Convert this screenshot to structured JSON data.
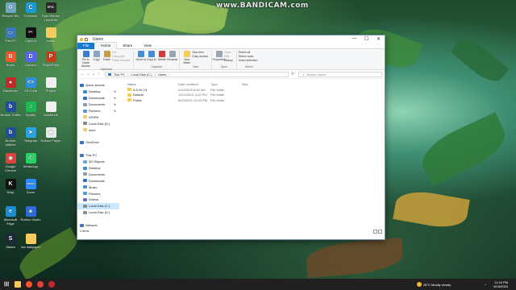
{
  "watermark": "www.BANDICAM.com",
  "desktop_icons": [
    {
      "label": "Recycle Bin",
      "icon": "recycle-bin-icon",
      "color": "#6fa7c9",
      "glyph": "♻"
    },
    {
      "label": "CCleaner",
      "icon": "ccleaner-icon",
      "color": "#1b9ad6",
      "glyph": "C"
    },
    {
      "label": "Epic Games Launcher",
      "icon": "epic-games-icon",
      "color": "#2a2a2a",
      "glyph": "EPIC"
    },
    {
      "label": "This PC",
      "icon": "this-pc-icon",
      "color": "#3a78c2",
      "glyph": "▭"
    },
    {
      "label": "CapCut",
      "icon": "capcut-icon",
      "color": "#111111",
      "glyph": "✂"
    },
    {
      "label": "cursor",
      "icon": "folder-icon",
      "color": "#f6cb5e",
      "glyph": ""
    },
    {
      "label": "Brave",
      "icon": "brave-icon",
      "color": "#fb542b",
      "glyph": "B"
    },
    {
      "label": "Discord",
      "icon": "discord-icon",
      "color": "#5865f2",
      "glyph": "D"
    },
    {
      "label": "PowerPoint",
      "icon": "powerpoint-icon",
      "color": "#c43e1c",
      "glyph": "P"
    },
    {
      "label": "Bandicam",
      "icon": "bandicam-icon",
      "color": "#c62828",
      "glyph": "●"
    },
    {
      "label": "VS Code",
      "icon": "vscode-icon",
      "color": "#2f8fdb",
      "glyph": "<>"
    },
    {
      "label": "Project",
      "icon": "project-icon",
      "color": "#f0f0f0",
      "glyph": ""
    },
    {
      "label": "Brother Crafts",
      "icon": "brother-icon",
      "color": "#1e4e9c",
      "glyph": "b"
    },
    {
      "label": "Spotify",
      "icon": "spotify-icon",
      "color": "#1db954",
      "glyph": "♫"
    },
    {
      "label": "AnkiMonk",
      "icon": "anki-icon",
      "color": "#f0f0f0",
      "glyph": ""
    },
    {
      "label": "Brother Utilities",
      "icon": "brother-utilities-icon",
      "color": "#1e4e9c",
      "glyph": "b"
    },
    {
      "label": "Telegram",
      "icon": "telegram-icon",
      "color": "#2aa3df",
      "glyph": "➤"
    },
    {
      "label": "Roblox Player",
      "icon": "roblox-icon",
      "color": "#e8e8e8",
      "glyph": "◆"
    },
    {
      "label": "Google Chrome",
      "icon": "chrome-icon",
      "color": "#e0413a",
      "glyph": "◉"
    },
    {
      "label": "WhatsApp",
      "icon": "whatsapp-icon",
      "color": "#25d366",
      "glyph": "✆"
    },
    {
      "label": "Krisp",
      "icon": "krisp-icon",
      "color": "#111111",
      "glyph": "K"
    },
    {
      "label": "Zoom",
      "icon": "zoom-icon",
      "color": "#2d8cff",
      "glyph": "zoom"
    },
    {
      "label": "Microsoft Edge",
      "icon": "edge-icon",
      "color": "#1b8fd6",
      "glyph": "e"
    },
    {
      "label": "Roblox Studio",
      "icon": "roblox-studio-icon",
      "color": "#2c6bd8",
      "glyph": "◈"
    },
    {
      "label": "Steam",
      "icon": "steam-icon",
      "color": "#1b2838",
      "glyph": "S"
    },
    {
      "label": "live wallpaper",
      "icon": "folder-icon",
      "color": "#f6cb5e",
      "glyph": ""
    }
  ],
  "window": {
    "title": "Users",
    "controls": {
      "minimize": "—",
      "maximize": "☐",
      "close": "✕"
    },
    "tabs": [
      {
        "label": "File",
        "kind": "file"
      },
      {
        "label": "Home",
        "kind": "active"
      },
      {
        "label": "Share",
        "kind": ""
      },
      {
        "label": "View",
        "kind": ""
      }
    ],
    "ribbon": {
      "clipboard": {
        "name": "Clipboard",
        "pin_label": "Pin to Quick access",
        "copy_label": "Copy",
        "paste_label": "Paste",
        "cut": "Cut",
        "copy_path": "Copy path",
        "paste_shortcut": "Paste shortcut"
      },
      "organize": {
        "name": "Organize",
        "move_label": "Move to",
        "copy_label": "Copy to",
        "delete_label": "Delete",
        "rename_label": "Rename"
      },
      "new": {
        "name": "New",
        "new_folder": "New folder",
        "new_item": "New item",
        "easy_access": "Easy access"
      },
      "open": {
        "name": "Open",
        "properties": "Properties",
        "open": "Open",
        "edit": "Edit",
        "history": "History"
      },
      "select": {
        "name": "Select",
        "select_all": "Select all",
        "select_none": "Select none",
        "invert": "Invert selection"
      }
    },
    "address": {
      "back": "←",
      "forward": "→",
      "recent": "⌄",
      "up": "↑",
      "crumbs": [
        "This PC",
        "›",
        "Local Disk (C:)",
        "›",
        "Users",
        "›"
      ],
      "refresh": "↻",
      "search_icon": "⌕",
      "search_placeholder": "Search Users"
    },
    "nav_pane": [
      {
        "label": "Quick access",
        "level": "top",
        "icon_color": "#2a73cc",
        "pinned": false
      },
      {
        "label": "Desktop",
        "level": "",
        "icon_color": "#3a8bd8",
        "pinned": true
      },
      {
        "label": "Downloads",
        "level": "",
        "icon_color": "#2a73cc",
        "pinned": true
      },
      {
        "label": "Documents",
        "level": "",
        "icon_color": "#8a9bb3",
        "pinned": true
      },
      {
        "label": "Pictures",
        "level": "",
        "icon_color": "#4aa0d6",
        "pinned": true
      },
      {
        "label": "WORK",
        "level": "",
        "icon_color": "#f6cb5e",
        "pinned": false
      },
      {
        "label": "Local Disk (D:)",
        "level": "",
        "icon_color": "#8a8a8a",
        "pinned": false
      },
      {
        "label": "work",
        "level": "",
        "icon_color": "#f6cb5e",
        "pinned": false
      },
      {
        "label": "",
        "level": "",
        "icon_color": "transparent",
        "pinned": false
      },
      {
        "label": "OneDrive",
        "level": "top",
        "icon_color": "#2a73cc",
        "pinned": false
      },
      {
        "label": "",
        "level": "",
        "icon_color": "transparent",
        "pinned": false
      },
      {
        "label": "This PC",
        "level": "top",
        "icon_color": "#3a78c2",
        "pinned": false
      },
      {
        "label": "3D Objects",
        "level": "",
        "icon_color": "#5aaee8",
        "pinned": false
      },
      {
        "label": "Desktop",
        "level": "",
        "icon_color": "#3a8bd8",
        "pinned": false
      },
      {
        "label": "Documents",
        "level": "",
        "icon_color": "#8a9bb3",
        "pinned": false
      },
      {
        "label": "Downloads",
        "level": "",
        "icon_color": "#2a73cc",
        "pinned": false
      },
      {
        "label": "Music",
        "level": "",
        "icon_color": "#4a8fd6",
        "pinned": false
      },
      {
        "label": "Pictures",
        "level": "",
        "icon_color": "#4aa0d6",
        "pinned": false
      },
      {
        "label": "Videos",
        "level": "",
        "icon_color": "#6a6ad0",
        "pinned": false
      },
      {
        "label": "Local Disk (C:)",
        "level": "",
        "icon_color": "#8a8a8a",
        "pinned": false,
        "selected": true
      },
      {
        "label": "Local Disk (D:)",
        "level": "",
        "icon_color": "#8a8a8a",
        "pinned": false
      },
      {
        "label": "",
        "level": "",
        "icon_color": "transparent",
        "pinned": false
      },
      {
        "label": "Network",
        "level": "top",
        "icon_color": "#3a78c2",
        "pinned": false
      }
    ],
    "columns": {
      "name": "Name",
      "date": "Date modified",
      "type": "Type",
      "size": "Size"
    },
    "files": [
      {
        "name": "A D M I N",
        "date": "5/10/2023 8:45 AM",
        "type": "File folder",
        "size": ""
      },
      {
        "name": "Default",
        "date": "11/22/2021 3:12 PM",
        "type": "File folder",
        "size": ""
      },
      {
        "name": "Public",
        "date": "8/23/2022 10:53 PM",
        "type": "File folder",
        "size": ""
      }
    ],
    "status": "3 items"
  },
  "taskbar": {
    "apps": [
      {
        "name": "start-button",
        "color": "#202020",
        "glyph": "⊞"
      },
      {
        "name": "file-explorer-taskbar-icon",
        "color": "#f6cb5e",
        "glyph": ""
      },
      {
        "name": "brave-taskbar-icon",
        "color": "#fb542b",
        "glyph": ""
      },
      {
        "name": "chrome-taskbar-icon",
        "color": "#e0413a",
        "glyph": ""
      },
      {
        "name": "bandicam-taskbar-icon",
        "color": "#c62828",
        "glyph": ""
      }
    ],
    "weather": "26°C  Mostly cloudy",
    "time": "11:16 PM",
    "date": "5/18/2023",
    "tray_caret": "^"
  },
  "colors": {
    "accent": "#1979ca",
    "selection": "#cce8ff",
    "taskbar": "#202020"
  }
}
